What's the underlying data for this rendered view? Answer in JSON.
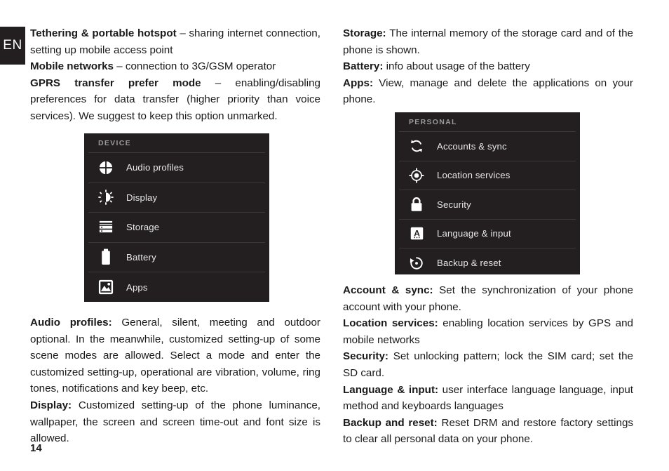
{
  "page": {
    "language_tab": "EN",
    "number": "14"
  },
  "left_column": {
    "paragraphs": [
      {
        "id": "tethering",
        "term": "Tethering & portable hotspot",
        "text": " – sharing internet connection, setting up mobile access point"
      },
      {
        "id": "mobile-networks",
        "term": "Mobile networks",
        "text": " – connection to 3G/GSM operator"
      },
      {
        "id": "gprs",
        "term": "GPRS transfer prefer mode",
        "text": " – enabling/disabling preferences for data transfer (higher priority than voice services). We suggest to keep this option unmarked."
      }
    ],
    "paragraphs_below": [
      {
        "id": "audio-profiles",
        "term": "Audio profiles:",
        "text": " General, silent, meeting and outdoor optional. In the meanwhile, customized setting-up of some scene modes are allowed. Select a mode and enter the customized setting-up, operational are vibration, volume, ring tones, notifications and key beep, etc."
      },
      {
        "id": "display",
        "term": "Display:",
        "text": " Customized setting-up of the phone luminance, wallpaper, the screen and screen time-out and font size is allowed."
      }
    ]
  },
  "right_column": {
    "paragraphs_above": [
      {
        "id": "storage",
        "term": "Storage:",
        "text": " The internal memory of the storage card and of the phone is shown."
      },
      {
        "id": "battery",
        "term": "Battery:",
        "text": " info about usage of the battery"
      },
      {
        "id": "apps",
        "term": "Apps:",
        "text": " View, manage and delete the applications on your phone."
      }
    ],
    "paragraphs_below": [
      {
        "id": "account-sync",
        "term": "Account & sync:",
        "text": " Set the synchronization of your phone account with your phone."
      },
      {
        "id": "location-services",
        "term": "Location services:",
        "text": " enabling location services by GPS and mobile networks"
      },
      {
        "id": "security",
        "term": "Security:",
        "text": " Set unlocking pattern; lock the SIM card; set the SD card."
      },
      {
        "id": "language-input",
        "term": "Language & input:",
        "text": " user interface language language, input method and keyboards languages"
      },
      {
        "id": "backup-reset",
        "term": "Backup and reset:",
        "text": " Reset DRM and restore factory settings to clear all personal data on your phone."
      }
    ]
  },
  "device_panel": {
    "header": "DEVICE",
    "items": [
      {
        "label": "Audio profiles",
        "icon": "audio-profiles-icon"
      },
      {
        "label": "Display",
        "icon": "brightness-icon"
      },
      {
        "label": "Storage",
        "icon": "storage-icon"
      },
      {
        "label": "Battery",
        "icon": "battery-icon"
      },
      {
        "label": "Apps",
        "icon": "apps-image-icon"
      }
    ]
  },
  "personal_panel": {
    "header": "PERSONAL",
    "items": [
      {
        "label": "Accounts & sync",
        "icon": "sync-icon"
      },
      {
        "label": "Location services",
        "icon": "location-crosshair-icon"
      },
      {
        "label": "Security",
        "icon": "lock-icon"
      },
      {
        "label": "Language & input",
        "icon": "keyboard-a-icon"
      },
      {
        "label": "Backup & reset",
        "icon": "backup-restore-icon"
      }
    ]
  },
  "colors": {
    "panel_background": "#231f20",
    "panel_label": "#e8e8e8",
    "panel_header_text": "#9a9a9a",
    "page_text": "#1a1a1a"
  }
}
